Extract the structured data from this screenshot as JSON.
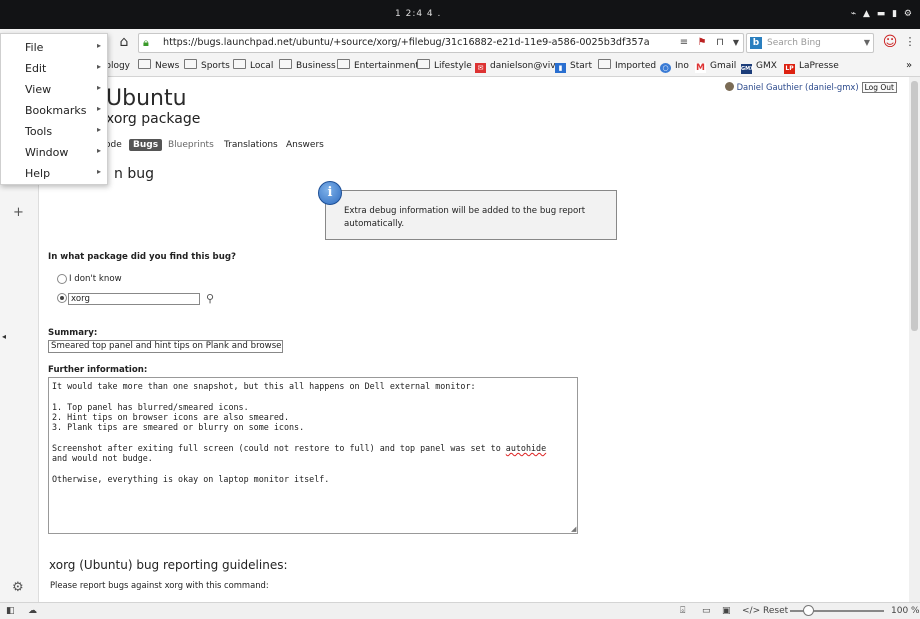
{
  "system": {
    "clock": "1 2:4 4 ."
  },
  "navbar": {
    "url": "https://bugs.launchpad.net/ubuntu/+source/xorg/+filebug/31c16882-e21d-11e9-a586-0025b3df357a",
    "search_placeholder": "Search Bing",
    "search_engine_icon": "bing-icon"
  },
  "bookmarks": [
    "Technology",
    "News",
    "Sports",
    "Local",
    "Business",
    "Entertainment",
    "Lifestyle",
    "danielson@viv",
    "Start",
    "Imported",
    "Ino",
    "Gmail",
    "GMX",
    "LaPresse"
  ],
  "menu": {
    "items": [
      {
        "label": "File"
      },
      {
        "label": "Edit"
      },
      {
        "label": "View"
      },
      {
        "label": "Bookmarks"
      },
      {
        "label": "Tools"
      },
      {
        "label": "Window"
      },
      {
        "label": "Help"
      }
    ]
  },
  "page": {
    "site_title": "Ubuntu",
    "package_title": "xorg package",
    "tabs": [
      {
        "label": "Code",
        "shown": "ode"
      },
      {
        "label": "Bugs",
        "active": true
      },
      {
        "label": "Blueprints"
      },
      {
        "label": "Translations"
      },
      {
        "label": "Answers"
      }
    ],
    "section_title_partial": "n bug",
    "user_link": "Daniel Gauthier (daniel-gmx)",
    "logout_label": "Log Out",
    "info_message": "Extra debug information will be added to the bug report automatically.",
    "package_question": "In what package did you find this bug?",
    "option_dont_know": "I don't know",
    "package_value": "xorg",
    "summary_label": "Summary:",
    "summary_value": "Smeared top panel and hint tips on Plank and browser icon",
    "further_label": "Further information:",
    "description_lines": [
      "It would take more than one snapshot, but this all happens on Dell external monitor:",
      "",
      "1. Top panel has blurred/smeared icons.",
      "2. Hint tips on browser icons are also smeared.",
      "3. Plank tips are smeared or blurry on some icons.",
      "",
      "Screenshot after exiting full screen (could not restore to full) and top panel was set to autohide",
      "and would not budge.",
      "",
      "Otherwise, everything is okay on laptop monitor itself."
    ],
    "guidelines_title": "xorg (Ubuntu) bug reporting guidelines:",
    "guidelines_text": "Please report bugs against xorg with this command:"
  },
  "status": {
    "reset_label": "Reset",
    "zoom": "100 %"
  }
}
